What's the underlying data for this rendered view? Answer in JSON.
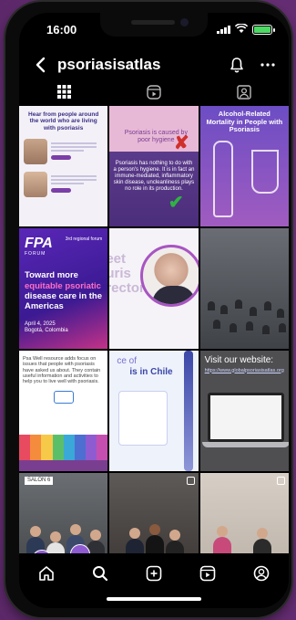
{
  "status_bar": {
    "time": "16:00"
  },
  "header": {
    "username": "psoriasisatlas"
  },
  "tabs": [
    {
      "name": "posts-grid",
      "icon": "grid-icon",
      "active": true
    },
    {
      "name": "reels",
      "icon": "reels-icon",
      "active": false
    },
    {
      "name": "tagged",
      "icon": "tagged-icon",
      "active": false
    }
  ],
  "posts": {
    "p1": {
      "title": "Hear from people around the world who are living with psoriasis"
    },
    "p2": {
      "caption": "Psoriasis is caused by poor hygiene",
      "body": "Psoriasis has nothing to do with a person's hygiene. It is in fact an immune-mediated, inflammatory skin disease, uncleanliness plays no role in its production."
    },
    "p3": {
      "title": "Alcohol-Related Mortality in People with Psoriasis"
    },
    "p4": {
      "logo": "FPA",
      "logo_sub": "FORUM",
      "tag": "3rd regional forum",
      "headline_1": "Toward more",
      "headline_accent": "equitable psoriatic",
      "headline_2": "disease care in the Americas",
      "date": "April 4, 2025",
      "place": "Bogotá, Colombia"
    },
    "p5": {
      "bg_text": "eet\nuris\nrector"
    },
    "p7": {
      "text": "Psa Well resource adds focus on issues that people with psoriasis have asked us about. They contain useful information and activities to help you to live well with psoriasis."
    },
    "p8": {
      "title": "ce of",
      "subtitle": "is in Chile"
    },
    "p9": {
      "title": "Visit our website:",
      "url": "https://www.globalpsoriasisatlas.org"
    },
    "p10": {
      "sign": "SALON 6"
    }
  },
  "colors": {
    "accent": "#a855c2",
    "page_bg": "#7a3d8a",
    "battery": "#4cd964"
  }
}
